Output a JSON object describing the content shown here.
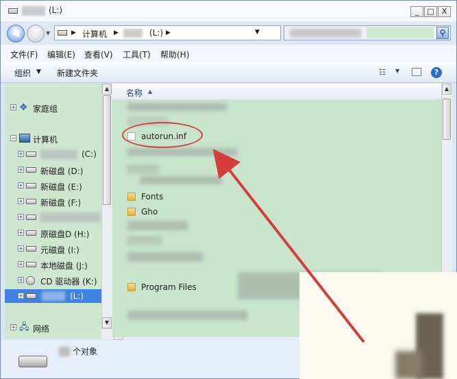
{
  "window": {
    "title": "(L:)",
    "minimize": "_",
    "maximize": "□",
    "close": "X"
  },
  "address": {
    "crumb_computer": "计算机",
    "crumb_drive": "(L:)",
    "sep": "▶"
  },
  "menu": [
    "文件(F)",
    "编辑(E)",
    "查看(V)",
    "工具(T)",
    "帮助(H)"
  ],
  "toolbar": {
    "organize": "组织",
    "new_folder": "新建文件夹"
  },
  "nav": {
    "homegroup": "家庭组",
    "computer": "计算机",
    "network": "网络",
    "drives": [
      "(C:)",
      "新磁盘 (D:)",
      "新磁盘 (E:)",
      "新磁盘 (F:)",
      "",
      "原磁盘D (H:)",
      "元磁盘 (I:)",
      "本地磁盘 (J:)",
      "CD 驱动器 (K:)",
      "(L:)"
    ]
  },
  "content": {
    "column_name": "名称",
    "files": [
      "autorun.inf",
      "Fonts",
      "Gho",
      "Program Files"
    ]
  },
  "status": {
    "count_text": "个对象"
  },
  "colors": {
    "annotation": "#d33d3d",
    "content_bg": "#c8e5cc",
    "selection": "#3e82e4"
  }
}
